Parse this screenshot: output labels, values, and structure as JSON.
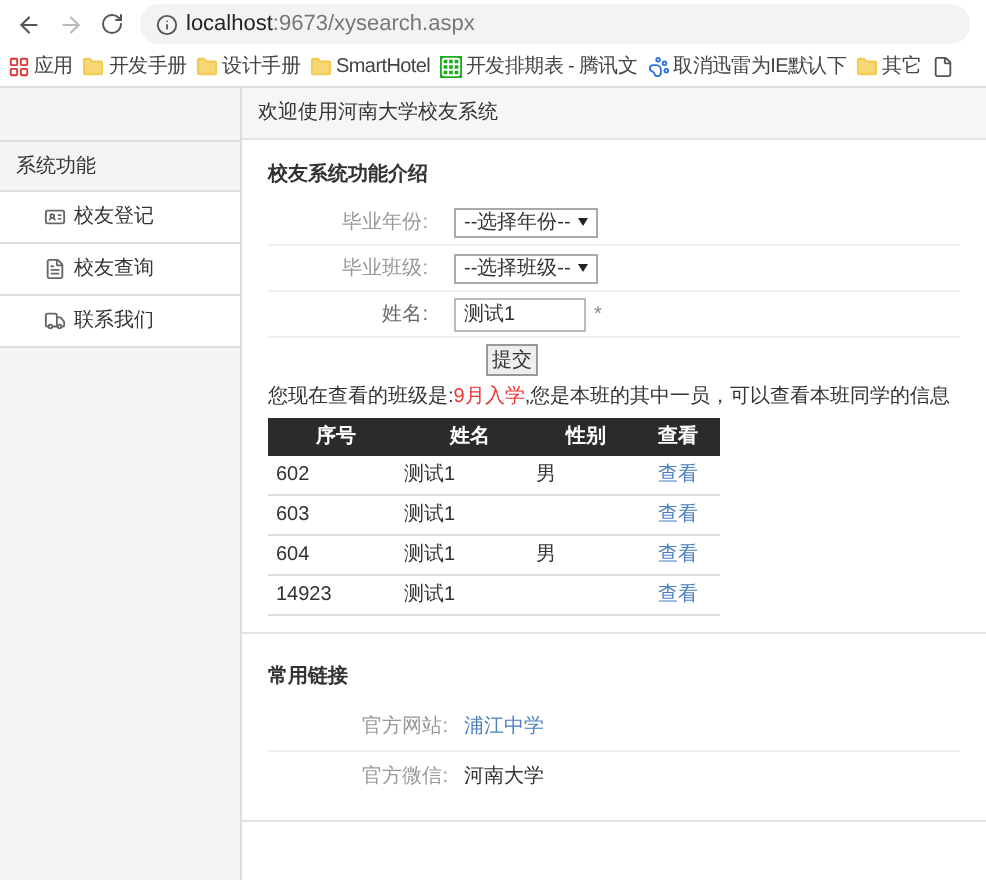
{
  "browser": {
    "url_host": "localhost",
    "url_path": ":9673/xysearch.aspx",
    "bookmarks": [
      {
        "label": "应用",
        "kind": "apps"
      },
      {
        "label": "开发手册",
        "kind": "folder"
      },
      {
        "label": "设计手册",
        "kind": "folder"
      },
      {
        "label": "SmartHotel",
        "kind": "folder"
      },
      {
        "label": "开发排期表 - 腾讯文",
        "kind": "sheet"
      },
      {
        "label": "取消迅雷为IE默认下",
        "kind": "paw"
      },
      {
        "label": "其它",
        "kind": "folder"
      }
    ]
  },
  "header": {
    "title": "欢迎使用河南大学校友系统"
  },
  "sidebar": {
    "title": "系统功能",
    "items": [
      {
        "label": "校友登记",
        "kind": "card"
      },
      {
        "label": "校友查询",
        "kind": "list"
      },
      {
        "label": "联系我们",
        "kind": "truck"
      }
    ]
  },
  "form": {
    "title": "校友系统功能介绍",
    "year_label": "毕业年份:",
    "year_value": "--选择年份--",
    "class_label": "毕业班级:",
    "class_value": "--选择班级--",
    "name_label": "姓名:",
    "name_value": "测试1",
    "required_mark": "*",
    "submit": "提交"
  },
  "notice": {
    "before": "您现在查看的班级是:",
    "highlight": "9月入学",
    "after": ",您是本班的其中一员，可以查看本班同学的信息"
  },
  "table": {
    "columns": [
      "序号",
      "姓名",
      "性别",
      "查看"
    ],
    "rows": [
      {
        "id": "602",
        "name": "测试1",
        "gender": "男",
        "action": "查看"
      },
      {
        "id": "603",
        "name": "测试1",
        "action": "查看"
      },
      {
        "id": "604",
        "name": "测试1",
        "gender": "男",
        "action": "查看"
      },
      {
        "id": "14923",
        "name": "测试1",
        "action": "查看"
      }
    ]
  },
  "links": {
    "title": "常用链接",
    "items": [
      {
        "label": "官方网站:",
        "value": "浦江中学",
        "kind": "link"
      },
      {
        "label": "官方微信:",
        "value": "河南大学",
        "kind": "text"
      }
    ]
  }
}
